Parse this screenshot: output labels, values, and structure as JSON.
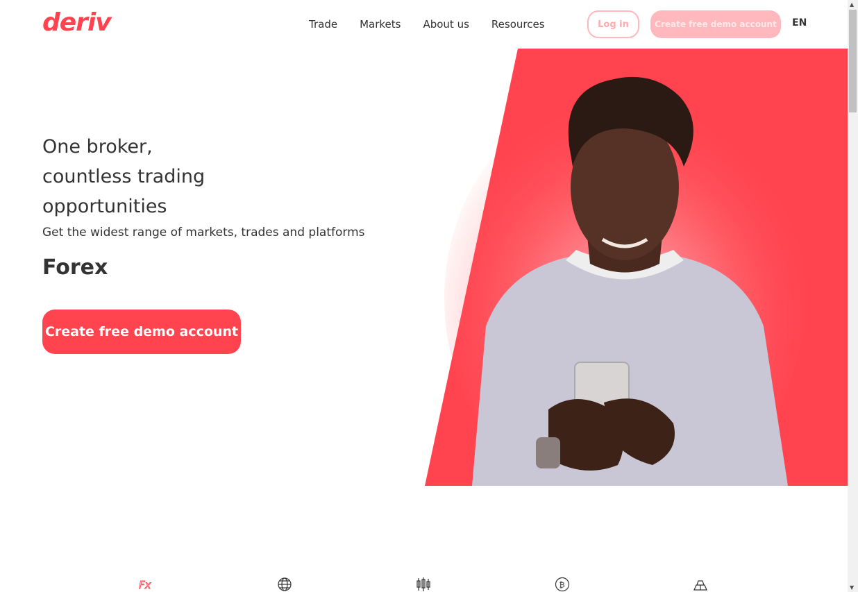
{
  "brand": {
    "logo_text": "deriv",
    "accent": "#ff444f"
  },
  "nav": {
    "items": [
      "Trade",
      "Markets",
      "About us",
      "Resources"
    ]
  },
  "header": {
    "login_label": "Log in",
    "demo_label": "Create free demo account",
    "language": "EN"
  },
  "hero": {
    "headline_lines": [
      "One broker,",
      "countless trading",
      "opportunities"
    ],
    "subtitle": "Get the widest range of markets, trades and platforms",
    "rotating_market": "Forex",
    "cta_label": "Create free demo account"
  },
  "market_icons": [
    "forex-icon",
    "globe-icon",
    "candlestick-icon",
    "cryptocurrency-icon",
    "commodities-icon"
  ]
}
